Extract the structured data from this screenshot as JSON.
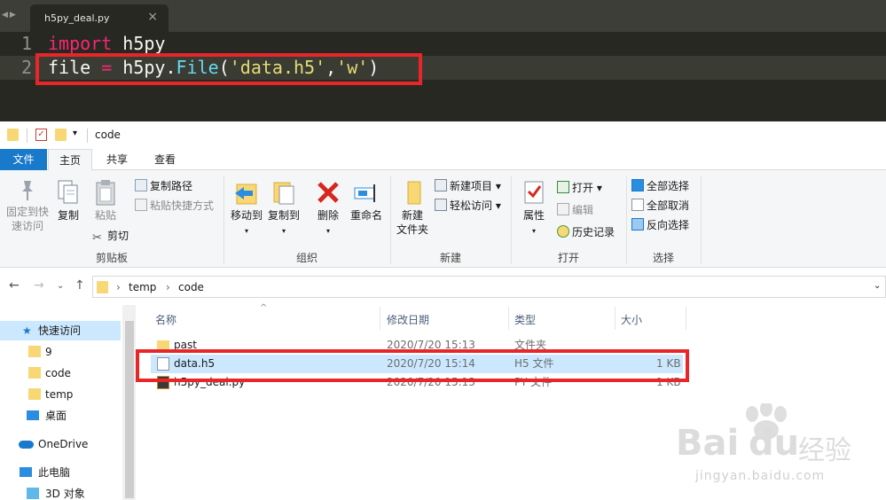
{
  "editor": {
    "tab_title": "h5py_deal.py",
    "tab_close": "×",
    "nav_arrows": "◀▶",
    "lines": [
      {
        "num": "1",
        "kw": "import",
        "rest": " h5py"
      },
      {
        "num": "2",
        "p1": "file",
        "p2": " = ",
        "p3": "h5py.",
        "p4": "File",
        "p5": "(",
        "p6": "'data.h5'",
        "p7": ",",
        "p8": "'w'",
        "p9": ")"
      }
    ]
  },
  "explorer": {
    "window_title": "code",
    "qat_dropdown": "▾",
    "ribbon_tabs": [
      "文件",
      "主页",
      "共享",
      "查看"
    ],
    "groups": {
      "clipboard": {
        "label": "剪贴板",
        "pin": "固定到快\n速访问",
        "copy": "复制",
        "paste": "粘贴",
        "copy_path": "复制路径",
        "paste_shortcut": "粘贴快捷方式",
        "cut": "剪切"
      },
      "organize": {
        "label": "组织",
        "move_to": "移动到",
        "copy_to": "复制到",
        "delete": "删除",
        "rename": "重命名"
      },
      "new": {
        "label": "新建",
        "new_folder": "新建\n文件夹",
        "new_item": "新建项目 ▾",
        "easy_access": "轻松访问 ▾"
      },
      "open": {
        "label": "打开",
        "properties": "属性",
        "open": "打开 ▾",
        "edit": "编辑",
        "history": "历史记录"
      },
      "select": {
        "label": "选择",
        "select_all": "全部选择",
        "select_none": "全部取消",
        "invert": "反向选择"
      }
    },
    "address": {
      "crumbs": [
        "temp",
        "code"
      ],
      "sep": "›"
    },
    "nav": [
      {
        "label": "快速访问",
        "icon": "star-icon"
      },
      {
        "label": "9",
        "icon": "folder-icon"
      },
      {
        "label": "code",
        "icon": "folder-icon"
      },
      {
        "label": "temp",
        "icon": "folder-icon"
      },
      {
        "label": "桌面",
        "icon": "desktop-icon"
      },
      {
        "label": "OneDrive",
        "icon": "cloud-icon"
      },
      {
        "label": "此电脑",
        "icon": "computer-icon"
      },
      {
        "label": "3D 对象",
        "icon": "cube-icon"
      }
    ],
    "columns": [
      "名称",
      "修改日期",
      "类型",
      "大小"
    ],
    "files": [
      {
        "name": "past",
        "date": "2020/7/20 15:13",
        "type": "文件夹",
        "size": ""
      },
      {
        "name": "data.h5",
        "date": "2020/7/20 15:14",
        "type": "H5 文件",
        "size": "1 KB"
      },
      {
        "name": "h5py_deal.py",
        "date": "2020/7/20 15:13",
        "type": "PY 文件",
        "size": "1 KB"
      }
    ]
  },
  "watermark": {
    "brand": "Bai",
    "brand2": "du",
    "cn": "经验",
    "url": "jingyan.baidu.com"
  },
  "colors": {
    "editor_bg": "#272822",
    "highlight_red": "#e8262a",
    "ribbon_file_tab": "#1979ca",
    "selection": "#cce8ff"
  }
}
